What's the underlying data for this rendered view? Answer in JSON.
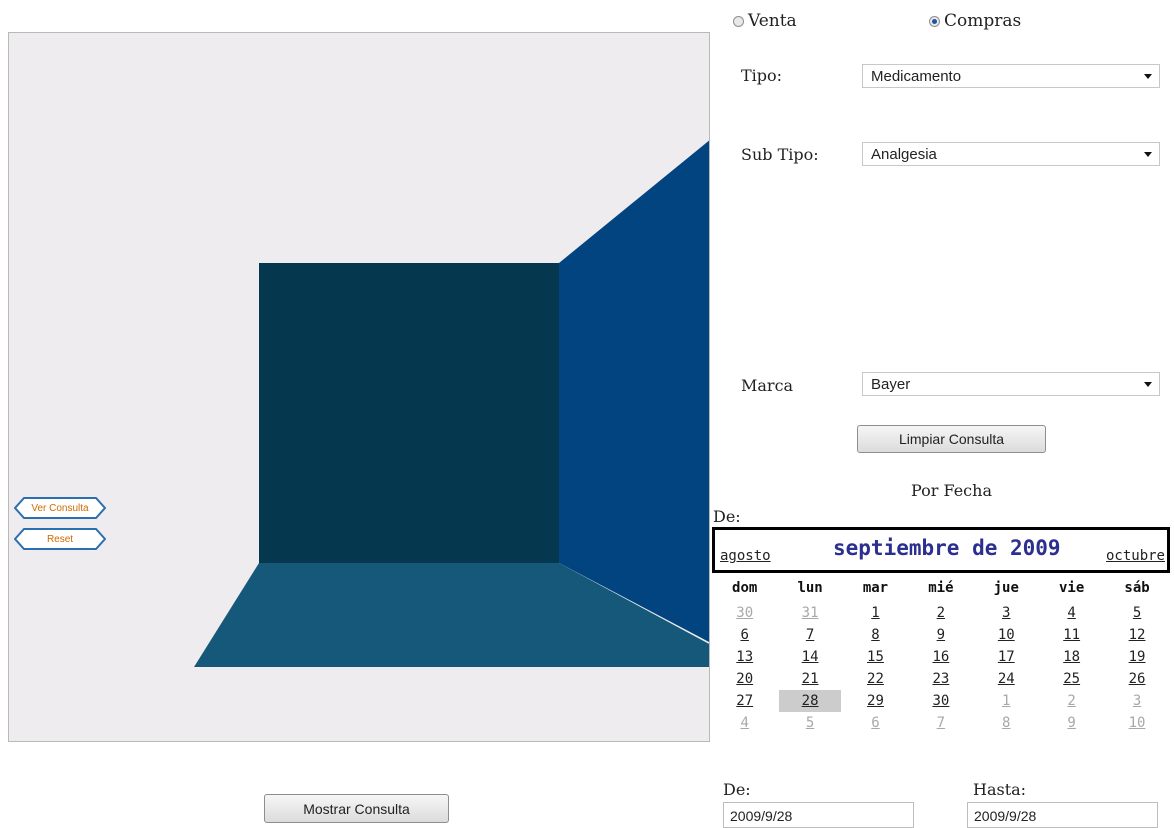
{
  "viewport": {
    "colors": {
      "background": "#eeecee",
      "back_wall": "#05384f",
      "right_wall": "#02447f",
      "floor": "#165879"
    }
  },
  "left_buttons": {
    "ver_consulta": "Ver Consulta",
    "reset": "Reset"
  },
  "mostrar_button": "Mostrar Consulta",
  "radios": {
    "venta": "Venta",
    "compras": "Compras",
    "selected": "compras"
  },
  "form": {
    "tipo_label": "Tipo:",
    "tipo_value": "Medicamento",
    "subtipo_label": "Sub Tipo:",
    "subtipo_value": "Analgesia",
    "marca_label": "Marca",
    "marca_value": "Bayer",
    "limpiar_button": "Limpiar Consulta",
    "por_fecha": "Por Fecha",
    "de_label": "De:"
  },
  "calendar": {
    "prev": "agosto",
    "title": "septiembre de 2009",
    "next": "octubre",
    "weekdays": [
      "dom",
      "lun",
      "mar",
      "mié",
      "jue",
      "vie",
      "sáb"
    ],
    "weeks": [
      [
        {
          "d": "30",
          "o": true
        },
        {
          "d": "31",
          "o": true
        },
        {
          "d": "1"
        },
        {
          "d": "2"
        },
        {
          "d": "3"
        },
        {
          "d": "4"
        },
        {
          "d": "5"
        }
      ],
      [
        {
          "d": "6"
        },
        {
          "d": "7"
        },
        {
          "d": "8"
        },
        {
          "d": "9"
        },
        {
          "d": "10"
        },
        {
          "d": "11"
        },
        {
          "d": "12"
        }
      ],
      [
        {
          "d": "13"
        },
        {
          "d": "14"
        },
        {
          "d": "15"
        },
        {
          "d": "16"
        },
        {
          "d": "17"
        },
        {
          "d": "18"
        },
        {
          "d": "19"
        }
      ],
      [
        {
          "d": "20"
        },
        {
          "d": "21"
        },
        {
          "d": "22"
        },
        {
          "d": "23"
        },
        {
          "d": "24"
        },
        {
          "d": "25"
        },
        {
          "d": "26"
        }
      ],
      [
        {
          "d": "27"
        },
        {
          "d": "28",
          "s": true
        },
        {
          "d": "29"
        },
        {
          "d": "30"
        },
        {
          "d": "1",
          "o": true
        },
        {
          "d": "2",
          "o": true
        },
        {
          "d": "3",
          "o": true
        }
      ],
      [
        {
          "d": "4",
          "o": true
        },
        {
          "d": "5",
          "o": true
        },
        {
          "d": "6",
          "o": true
        },
        {
          "d": "7",
          "o": true
        },
        {
          "d": "8",
          "o": true
        },
        {
          "d": "9",
          "o": true
        },
        {
          "d": "10",
          "o": true
        }
      ]
    ],
    "selected_color": "#cccccc",
    "title_color": "#2b2f8f"
  },
  "range": {
    "de_label": "De:",
    "de_value": "2009/9/28",
    "hasta_label": "Hasta:",
    "hasta_value": "2009/9/28"
  }
}
